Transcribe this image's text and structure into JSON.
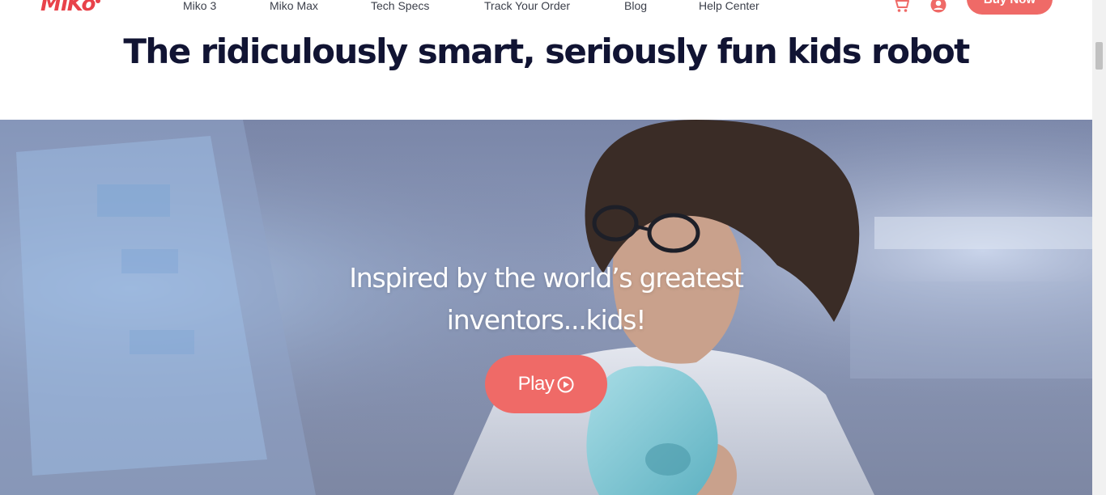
{
  "header": {
    "logo_text": "MiKo",
    "nav": [
      "Miko 3",
      "Miko Max",
      "Tech Specs",
      "Track Your Order",
      "Blog",
      "Help Center"
    ],
    "cart_icon": "cart-icon",
    "user_icon": "user-account-icon",
    "buy_label": "Buy Now"
  },
  "headline": "The ridiculously smart, seriously fun kids robot",
  "hero": {
    "title_line1": "Inspired by the world’s greatest",
    "title_line2": "inventors...kids!",
    "play_label": "Play",
    "play_icon": "play-circle-icon",
    "image_desc_icon": "hero-photo"
  },
  "colors": {
    "brand": "#e8424a",
    "button": "#ef6a67",
    "headline": "#111433"
  }
}
